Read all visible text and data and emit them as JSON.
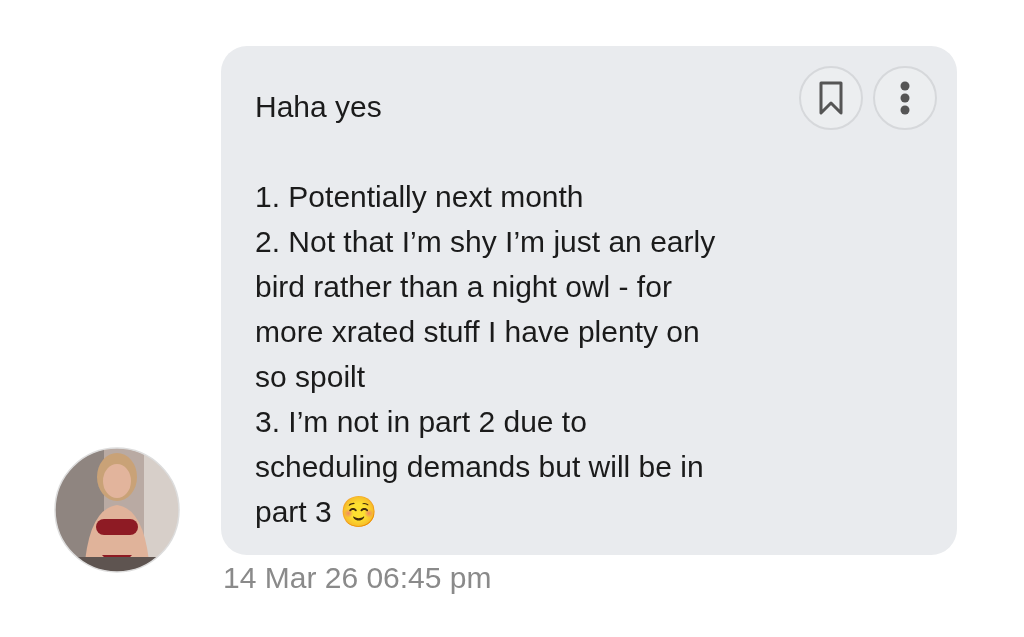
{
  "message": {
    "text": "Haha yes\n\n1. Potentially next month\n2. Not that I’m shy I’m just an early bird rather than a night owl - for more xrated stuff I have plenty on so spoilt\n3. I’m not in part 2 due to scheduling demands but will be in part 3 ☺️",
    "timestamp": "14 Mar 26 06:45 pm"
  }
}
